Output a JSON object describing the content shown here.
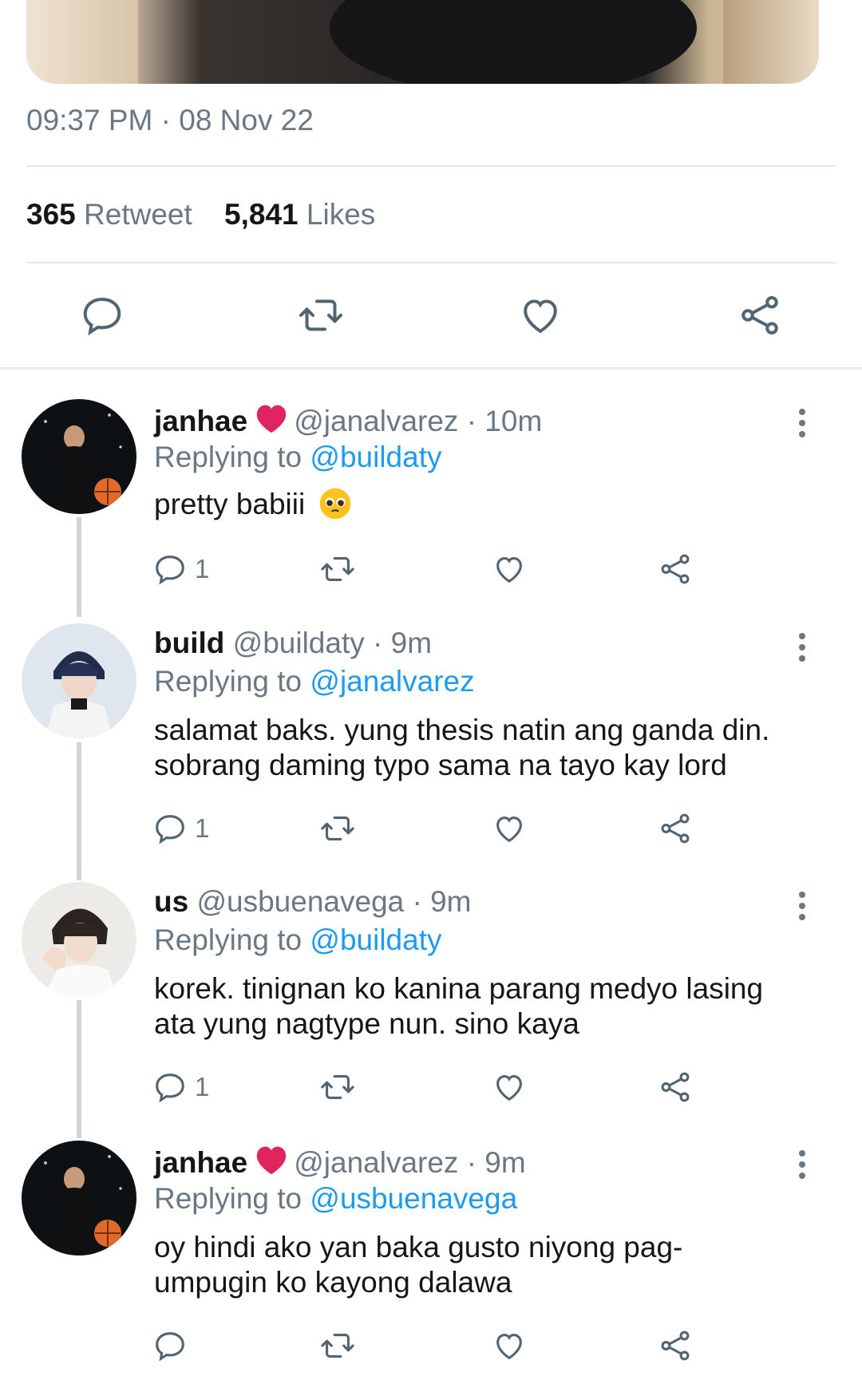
{
  "tweet": {
    "timestamp": "09:37 PM · 08 Nov 22",
    "retweets_count": "365",
    "retweets_label": "Retweet",
    "likes_count": "5,841",
    "likes_label": "Likes"
  },
  "colors": {
    "accent": "#1d9bf0",
    "muted": "#6b7884",
    "heart": "#e0245e"
  },
  "replies": [
    {
      "name": "janhae",
      "has_heart": true,
      "handle_time": "@janalvarez · 10m",
      "replying_label": "Replying to",
      "replying_to": "@buildaty",
      "text": "pretty babiii",
      "emoji": "pleading-face",
      "reply_count": "1"
    },
    {
      "name": "build",
      "has_heart": false,
      "handle_time": "@buildaty · 9m",
      "replying_label": "Replying to",
      "replying_to": "@janalvarez",
      "text_line1": "salamat baks. yung thesis natin ang ganda din.",
      "text_line2": "sobrang daming typo sama na tayo kay lord",
      "reply_count": "1"
    },
    {
      "name": "us",
      "has_heart": false,
      "handle_time": "@usbuenavega · 9m",
      "replying_label": "Replying to",
      "replying_to": "@buildaty",
      "text_line1": "korek. tinignan ko kanina parang medyo lasing",
      "text_line2": "ata yung nagtype nun. sino kaya",
      "reply_count": "1"
    },
    {
      "name": "janhae",
      "has_heart": true,
      "handle_time": "@janalvarez · 9m",
      "replying_label": "Replying to",
      "replying_to": "@usbuenavega",
      "text_line1": "oy hindi ako yan baka gusto niyong pag-",
      "text_line2": "umpugin ko kayong dalawa",
      "reply_count": ""
    }
  ]
}
